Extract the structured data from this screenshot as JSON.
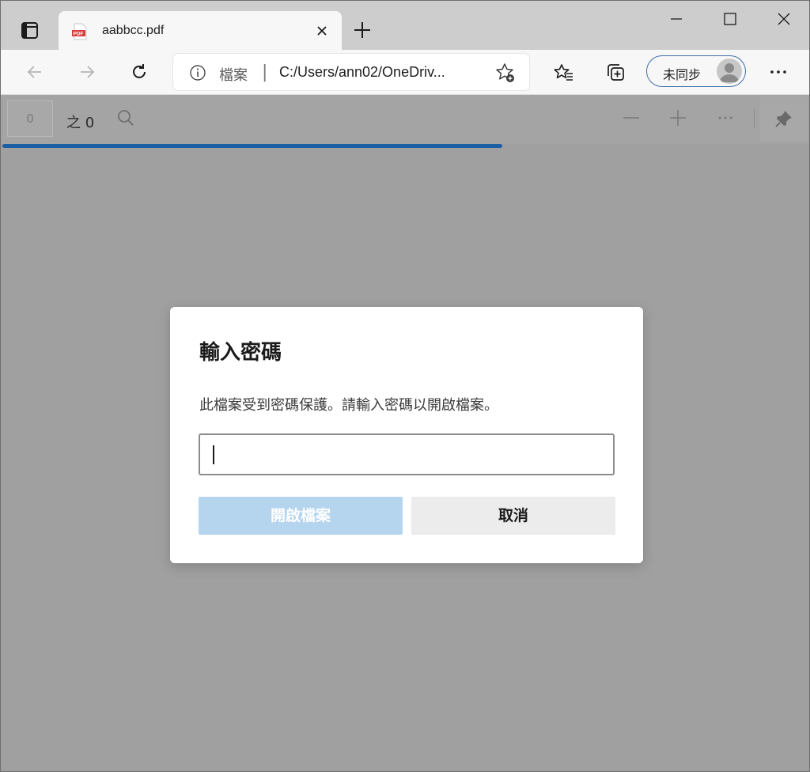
{
  "tab": {
    "title": "aabbcc.pdf",
    "icon": "pdf-icon"
  },
  "address_bar": {
    "label": "檔案",
    "separator": "|",
    "url": "C:/Users/ann02/OneDriv..."
  },
  "profile": {
    "sync_label": "未同步"
  },
  "pdf_toolbar": {
    "page_value": "0",
    "page_count": "之 0"
  },
  "load_progress": 0.62,
  "dialog": {
    "title": "輸入密碼",
    "message": "此檔案受到密碼保護。請輸入密碼以開啟檔案。",
    "password_value": "",
    "open_label": "開啟檔案",
    "cancel_label": "取消"
  },
  "colors": {
    "accent": "#1a5fa3",
    "primary_disabled": "#b5d4ee",
    "overlay": "#a0a0a0"
  }
}
